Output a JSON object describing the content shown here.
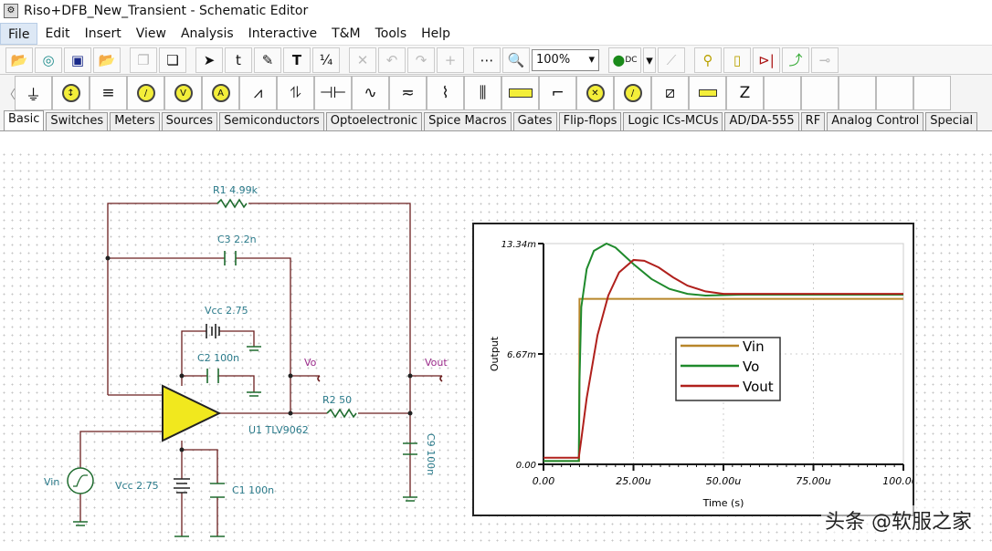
{
  "window": {
    "title": "Riso+DFB_New_Transient - Schematic Editor"
  },
  "menu": [
    "File",
    "Edit",
    "Insert",
    "View",
    "Analysis",
    "Interactive",
    "T&M",
    "Tools",
    "Help"
  ],
  "toolbar": {
    "zoom_value": "100%",
    "dc_label": "DC"
  },
  "component_tabs": [
    "Basic",
    "Switches",
    "Meters",
    "Sources",
    "Semiconductors",
    "Optoelectronic",
    "Spice Macros",
    "Gates",
    "Flip-flops",
    "Logic ICs-MCUs",
    "AD/DA-555",
    "RF",
    "Analog Control",
    "Special"
  ],
  "schematic": {
    "r1": "R1 4.99k",
    "c3": "C3 2.2n",
    "vcc_top": "Vcc 2.75",
    "c2": "C2 100n",
    "vo": "Vo",
    "vout": "Vout",
    "r2": "R2 50",
    "u1": "U1 TLV9062",
    "c9": "C9 100n",
    "vin": "Vin",
    "vcc_bottom": "Vcc 2.75",
    "c1": "C1 100n"
  },
  "chart_data": {
    "type": "line",
    "xlabel": "Time (s)",
    "ylabel": "Output",
    "xlim": [
      0,
      100
    ],
    "ylim": [
      0,
      13.34
    ],
    "x_ticks": [
      "0.00",
      "25.00u",
      "50.00u",
      "75.00u",
      "100.00u"
    ],
    "x_tick_values": [
      0,
      25,
      50,
      75,
      100
    ],
    "y_ticks": [
      "0.00",
      "6.67m",
      "13.34m"
    ],
    "y_tick_values": [
      0,
      6.67,
      13.34
    ],
    "grid": true,
    "legend": "center",
    "series": [
      {
        "name": "Vin",
        "color": "#b8862a",
        "points": [
          [
            0,
            0.2
          ],
          [
            9.9,
            0.2
          ],
          [
            10,
            10
          ],
          [
            100,
            10
          ]
        ]
      },
      {
        "name": "Vo",
        "color": "#1f8a2c",
        "points": [
          [
            0,
            0.2
          ],
          [
            9.8,
            0.2
          ],
          [
            10,
            5
          ],
          [
            10.5,
            9.5
          ],
          [
            12,
            11.8
          ],
          [
            14,
            12.9
          ],
          [
            17.5,
            13.34
          ],
          [
            20,
            13.1
          ],
          [
            25,
            12.1
          ],
          [
            30,
            11.2
          ],
          [
            35,
            10.6
          ],
          [
            40,
            10.3
          ],
          [
            45,
            10.2
          ],
          [
            55,
            10.25
          ],
          [
            100,
            10.25
          ]
        ]
      },
      {
        "name": "Vout",
        "color": "#b0201c",
        "points": [
          [
            0,
            0.4
          ],
          [
            9.8,
            0.4
          ],
          [
            10.5,
            1.5
          ],
          [
            12,
            4
          ],
          [
            15,
            7.8
          ],
          [
            18,
            10.2
          ],
          [
            21,
            11.6
          ],
          [
            25,
            12.35
          ],
          [
            28,
            12.3
          ],
          [
            32,
            11.9
          ],
          [
            36,
            11.3
          ],
          [
            40,
            10.8
          ],
          [
            45,
            10.45
          ],
          [
            50,
            10.3
          ],
          [
            100,
            10.3
          ]
        ]
      }
    ]
  },
  "watermark": "头条 @软服之家"
}
